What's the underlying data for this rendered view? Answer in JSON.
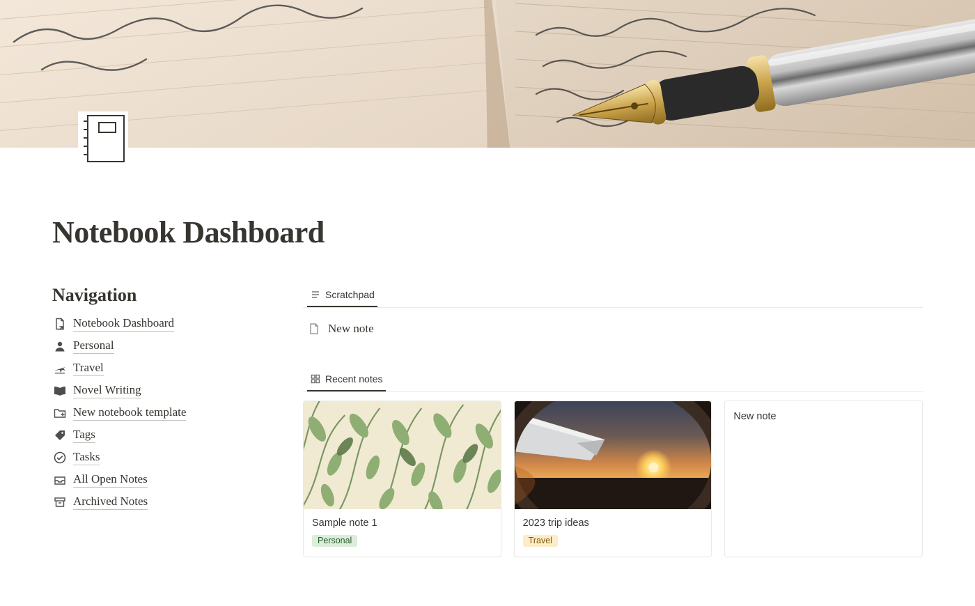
{
  "page": {
    "title": "Notebook Dashboard"
  },
  "navigation": {
    "heading": "Navigation",
    "items": [
      {
        "label": "Notebook Dashboard"
      },
      {
        "label": "Personal"
      },
      {
        "label": "Travel"
      },
      {
        "label": "Novel Writing"
      },
      {
        "label": "New notebook template"
      },
      {
        "label": "Tags"
      },
      {
        "label": "Tasks"
      },
      {
        "label": "All Open Notes"
      },
      {
        "label": "Archived Notes"
      }
    ]
  },
  "scratchpad": {
    "tab_label": "Scratchpad",
    "new_note_label": "New note"
  },
  "recent": {
    "tab_label": "Recent notes",
    "cards": [
      {
        "title": "Sample note 1",
        "tag": "Personal"
      },
      {
        "title": "2023 trip ideas",
        "tag": "Travel"
      },
      {
        "title": "New note"
      }
    ]
  }
}
